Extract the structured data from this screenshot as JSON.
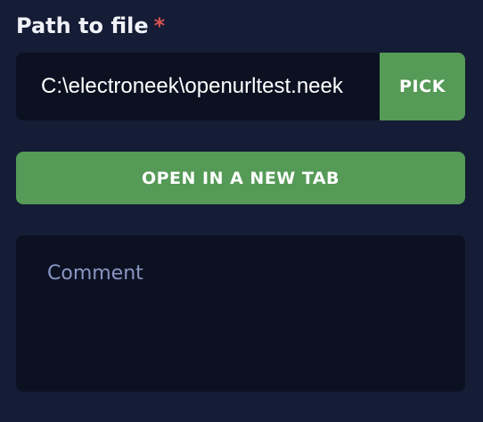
{
  "path_field": {
    "label": "Path to file",
    "required_mark": "*",
    "value": "C:\\electroneek\\openurltest.neek",
    "pick_label": "PICK"
  },
  "open_button": {
    "label": "OPEN IN A NEW TAB"
  },
  "comment": {
    "placeholder": "Comment",
    "value": ""
  },
  "colors": {
    "background": "#151c35",
    "input_background": "#0c1122",
    "accent_green": "#559a57",
    "required_red": "#d9534f",
    "placeholder": "#8a96c2"
  }
}
